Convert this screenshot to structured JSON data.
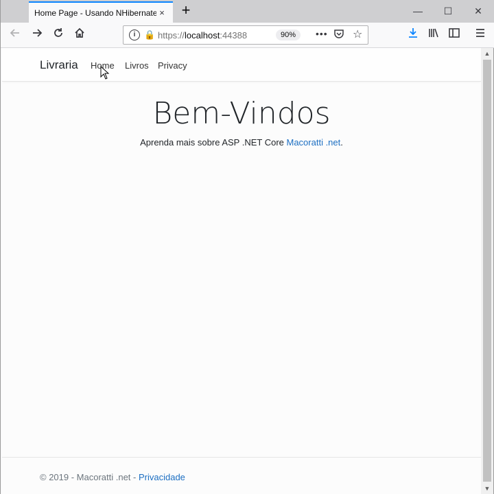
{
  "browser": {
    "tab_title": "Home Page - Usando NHibernate",
    "tab_close": "×",
    "new_tab": "+",
    "window_controls": {
      "minimize": "—",
      "maximize": "☐",
      "close": "✕"
    },
    "url_scheme": "https://",
    "url_host": "localhost",
    "url_port": ":44388",
    "zoom": "90%",
    "toolbar_icons": [
      "back-icon",
      "forward-icon",
      "reload-icon",
      "home-icon",
      "download-icon",
      "library-icon",
      "sidebar-icon",
      "menu-icon"
    ]
  },
  "site": {
    "brand": "Livraria",
    "nav": [
      "Home",
      "Livros",
      "Privacy"
    ],
    "hero_title": "Bem-Vindos",
    "lead_text": "Aprenda mais sobre ASP .NET Core ",
    "lead_link": "Macoratti .net",
    "lead_end": ".",
    "footer_text": "© 2019 - Macoratti .net - ",
    "footer_link": "Privacidade"
  },
  "colors": {
    "accent": "#0a84ff",
    "link": "#1b6ec2"
  }
}
